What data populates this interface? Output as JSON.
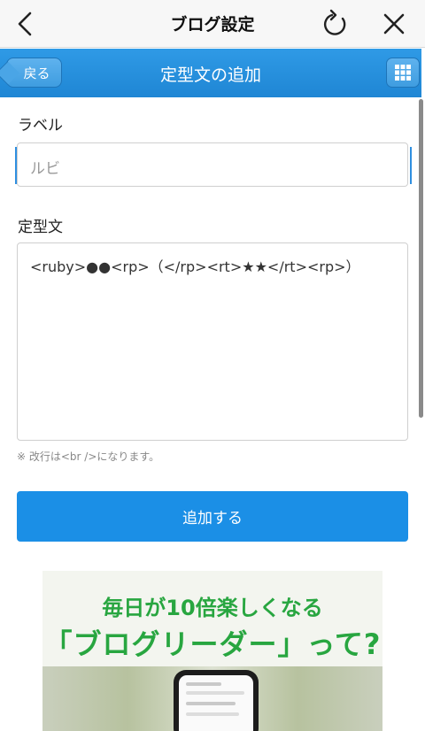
{
  "topbar": {
    "title": "ブログ設定",
    "icons": [
      "back-chevron-icon",
      "reload-icon",
      "close-icon"
    ]
  },
  "bluebar": {
    "back_label": "戻る",
    "title": "定型文の追加",
    "menu_icon": "grid-menu-icon",
    "color": "#2a90dd"
  },
  "form": {
    "label_heading": "ラベル",
    "label_value": "ルビ",
    "template_heading": "定型文",
    "template_value": "<ruby>●●<rp>（</rp><rt>★★</rt><rp>）",
    "hint": "※ 改行は<br />になります。",
    "submit_label": "追加する",
    "submit_color": "#1b8fe6"
  },
  "banner": {
    "line1": "毎日が10倍楽しくなる",
    "line2": "「ブログリーダー」って?",
    "accent": "#28a640"
  }
}
